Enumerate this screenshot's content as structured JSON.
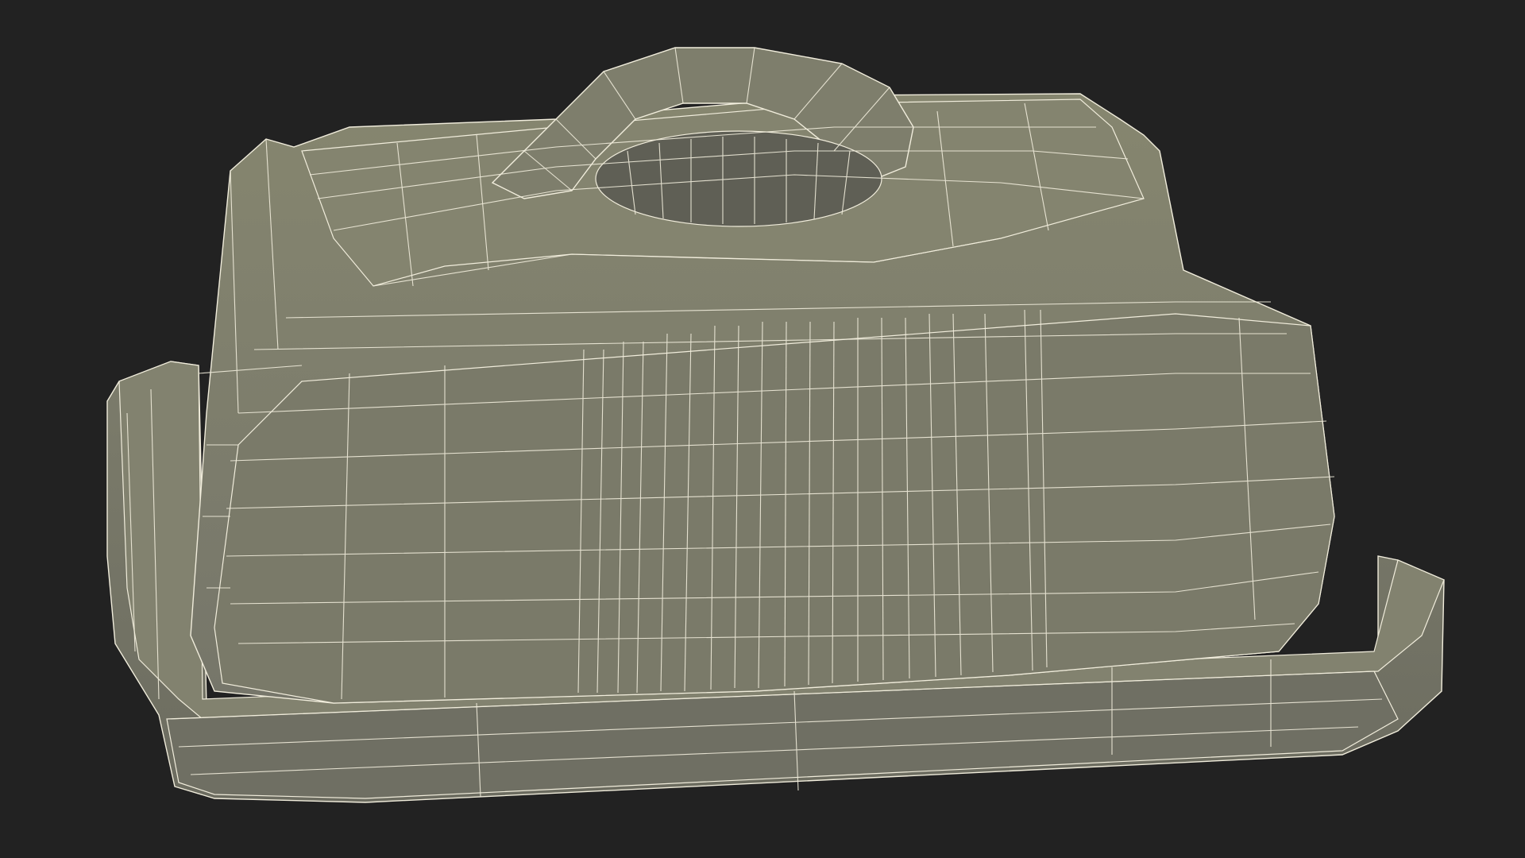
{
  "scene": {
    "subject": "butter-dish-wireframe-model",
    "colors": {
      "background": "#222222",
      "surface": "#7a7a69",
      "surface_light": "#8a8a78",
      "surface_shadow": "#64645a",
      "wire": "#f1eddc"
    }
  }
}
